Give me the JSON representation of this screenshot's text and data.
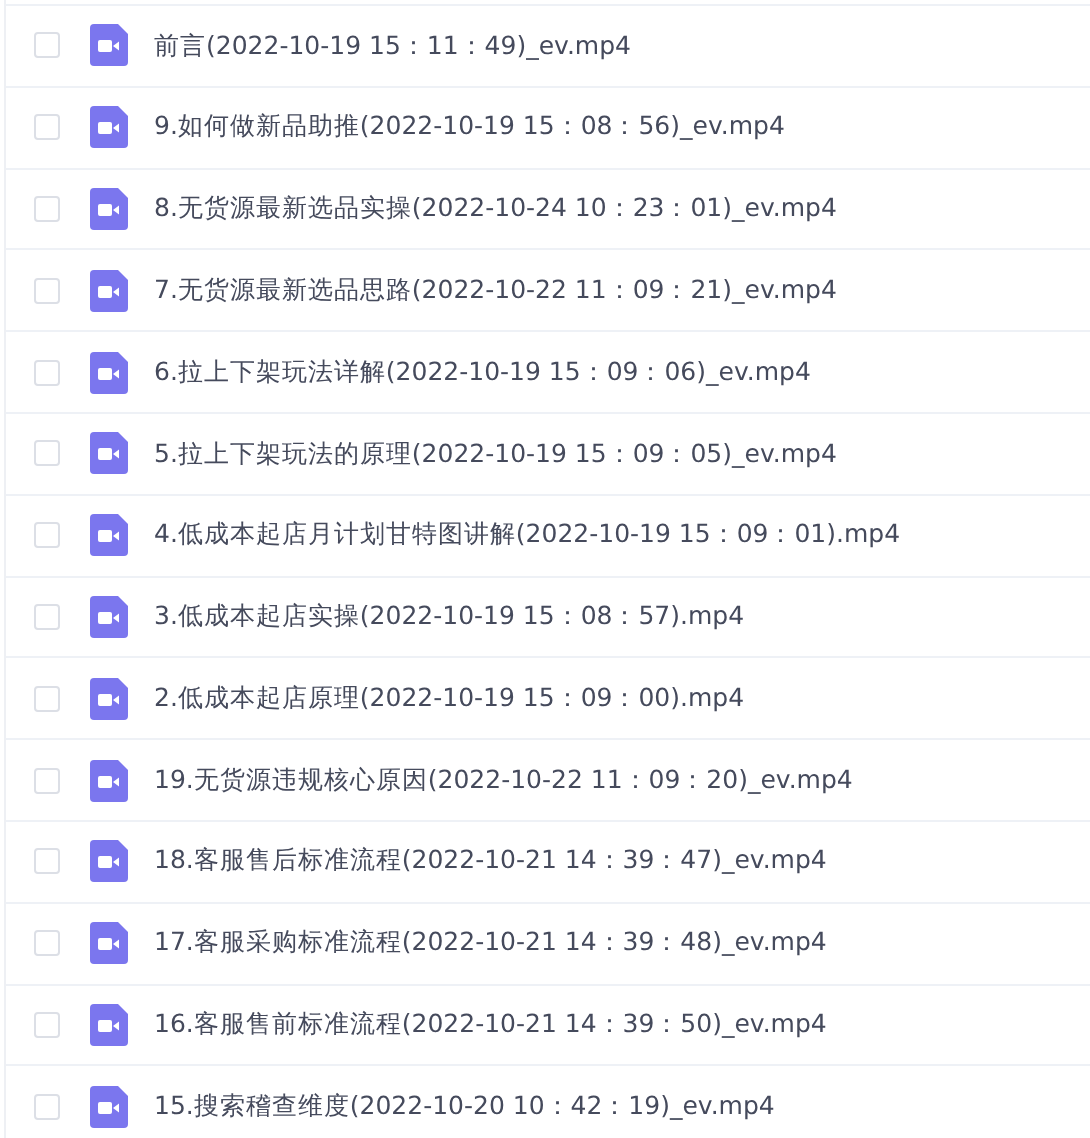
{
  "files": [
    {
      "name": "前言(2022-10-19 15：11：49)_ev.mp4",
      "checked": false
    },
    {
      "name": "9.如何做新品助推(2022-10-19 15：08：56)_ev.mp4",
      "checked": false
    },
    {
      "name": "8.无货源最新选品实操(2022-10-24 10：23：01)_ev.mp4",
      "checked": false
    },
    {
      "name": "7.无货源最新选品思路(2022-10-22 11：09：21)_ev.mp4",
      "checked": false
    },
    {
      "name": "6.拉上下架玩法详解(2022-10-19 15：09：06)_ev.mp4",
      "checked": false
    },
    {
      "name": "5.拉上下架玩法的原理(2022-10-19 15：09：05)_ev.mp4",
      "checked": false
    },
    {
      "name": "4.低成本起店月计划甘特图讲解(2022-10-19 15：09：01).mp4",
      "checked": false
    },
    {
      "name": "3.低成本起店实操(2022-10-19 15：08：57).mp4",
      "checked": false
    },
    {
      "name": "2.低成本起店原理(2022-10-19 15：09：00).mp4",
      "checked": false
    },
    {
      "name": "19.无货源违规核心原因(2022-10-22 11：09：20)_ev.mp4",
      "checked": false
    },
    {
      "name": "18.客服售后标准流程(2022-10-21 14：39：47)_ev.mp4",
      "checked": false
    },
    {
      "name": "17.客服采购标准流程(2022-10-21 14：39：48)_ev.mp4",
      "checked": false
    },
    {
      "name": "16.客服售前标准流程(2022-10-21 14：39：50)_ev.mp4",
      "checked": false
    },
    {
      "name": "15.搜索稽查维度(2022-10-20 10：42：19)_ev.mp4",
      "checked": false
    }
  ]
}
